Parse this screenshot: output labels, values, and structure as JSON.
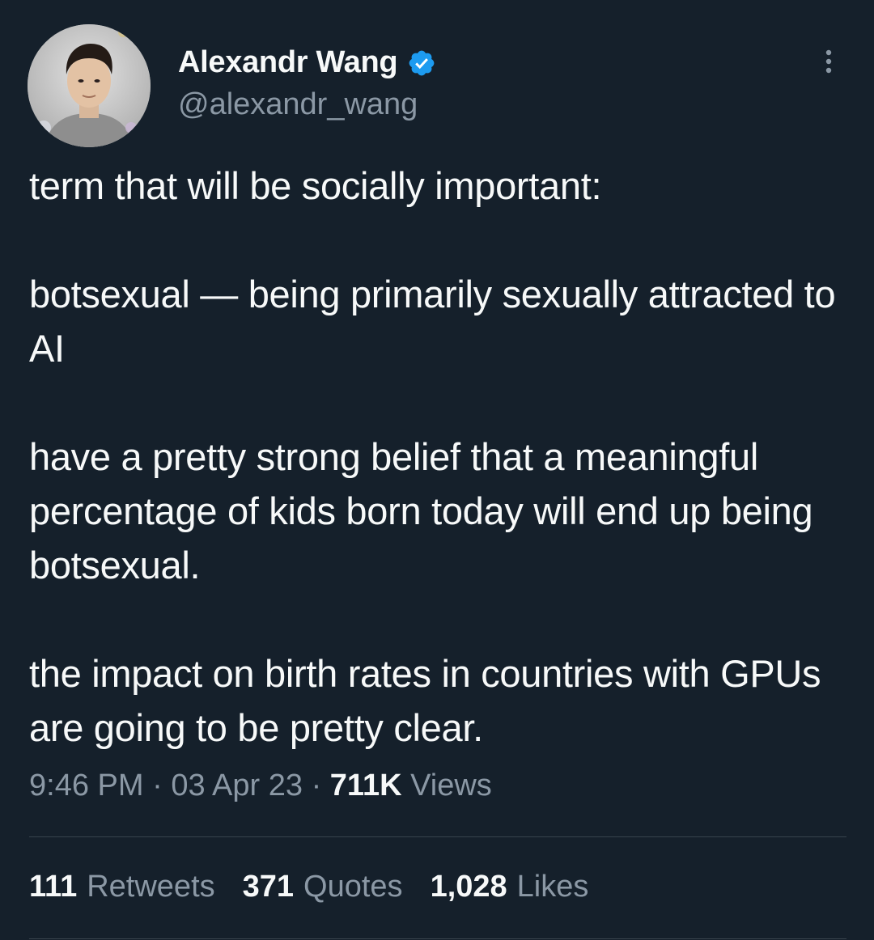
{
  "author": {
    "display_name": "Alexandr Wang",
    "handle": "@alexandr_wang",
    "verified_icon": "verified-badge-icon",
    "verified_color": "#1d9bf0"
  },
  "tweet": {
    "paragraphs": [
      "term that will be socially important:",
      "botsexual — being primarily sexually attracted to AI",
      "have a pretty strong belief that a meaningful percentage of kids born today will end up being botsexual.",
      "the impact on birth rates in countries with GPUs are going to be pretty clear."
    ],
    "time": "9:46 PM",
    "date": "03 Apr 23",
    "separator": "·",
    "views_count": "711K",
    "views_label": "Views"
  },
  "stats": {
    "retweets_count": "111",
    "retweets_label": "Retweets",
    "quotes_count": "371",
    "quotes_label": "Quotes",
    "likes_count": "1,028",
    "likes_label": "Likes"
  },
  "icons": {
    "more": "more-horizontal-icon"
  },
  "colors": {
    "background": "#15202b",
    "primary_text": "#f7f9f9",
    "secondary_text": "#8b98a5",
    "divider": "#38444d"
  }
}
